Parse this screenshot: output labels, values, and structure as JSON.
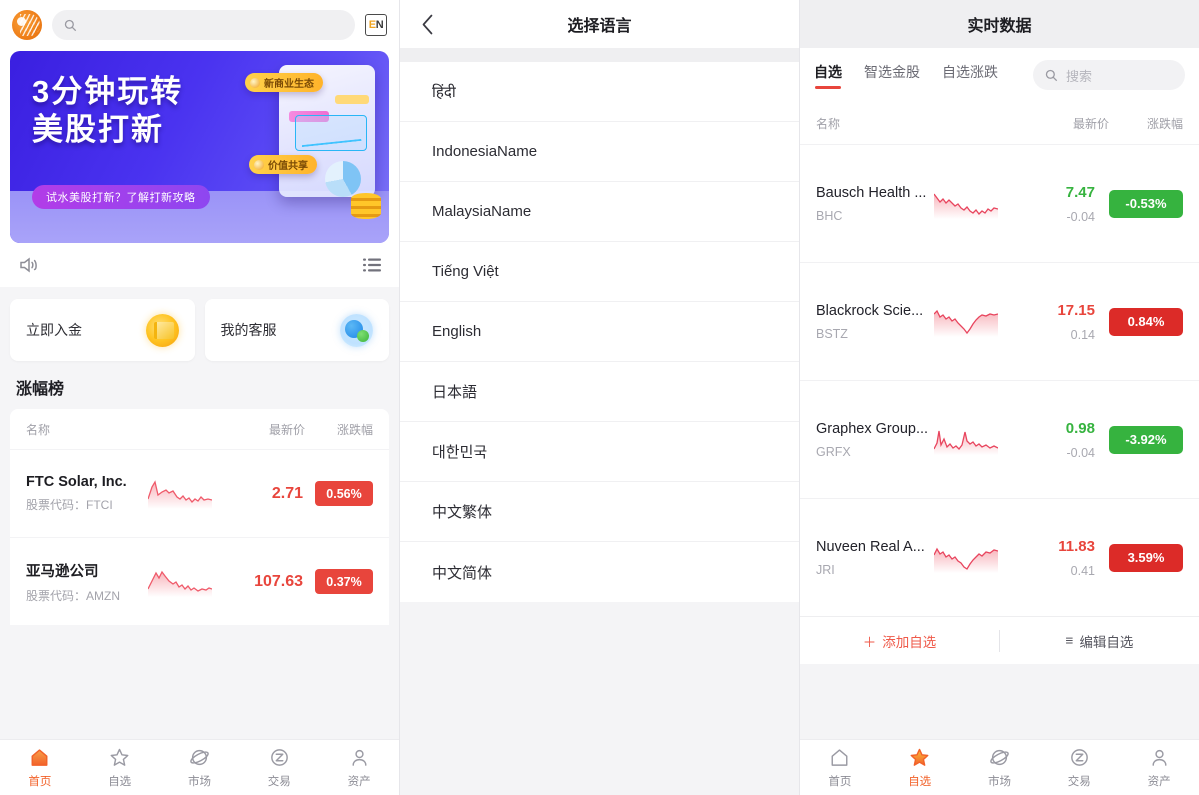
{
  "home": {
    "logo_name": "lion-logo",
    "search_placeholder": "",
    "lang_badge": {
      "first": "E",
      "second": "N"
    },
    "banner": {
      "line1": "3分钟玩转",
      "line2": "美股打新",
      "pill": "试水美股打新？了解打新攻略",
      "tag1": "新商业生态",
      "tag2": "价值共享"
    },
    "quick_actions": [
      {
        "label": "立即入金",
        "icon": "wallet-icon"
      },
      {
        "label": "我的客服",
        "icon": "customer-service-icon"
      }
    ],
    "section_title": "涨幅榜",
    "table_headers": {
      "name": "名称",
      "price": "最新价",
      "change": "涨跌幅"
    },
    "rows": [
      {
        "name": "FTC Solar, Inc.",
        "code_label": "股票代码：FTCI",
        "price": "2.71",
        "change": "0.56%",
        "direction": "up",
        "spark": "0,20 4,8 7,3 10,16 14,13 18,11 21,14 25,12 29,18 32,20 35,17 38,21 41,19 44,23 47,20 50,22 53,18 56,21 60,20 64,21"
      },
      {
        "name": "亚马逊公司",
        "code_label": "股票代码：AMZN",
        "price": "107.63",
        "change": "0.37%",
        "direction": "up",
        "spark": "0,22 4,14 8,6 11,11 14,5 17,9 21,14 25,17 28,15 31,20 34,18 37,22 40,19 43,23 46,21 50,24 54,22 58,23 61,21 64,22"
      }
    ],
    "nav": [
      {
        "label": "首页",
        "icon": "home-icon",
        "active": true
      },
      {
        "label": "自选",
        "icon": "star-icon",
        "active": false
      },
      {
        "label": "市场",
        "icon": "market-planet-icon",
        "active": false
      },
      {
        "label": "交易",
        "icon": "trade-icon",
        "active": false
      },
      {
        "label": "资产",
        "icon": "assets-person-icon",
        "active": false
      }
    ]
  },
  "language": {
    "title": "选择语言",
    "back_icon": "chevron-left-icon",
    "items": [
      "हिंदी",
      "IndonesiaName",
      "MalaysiaName",
      "Tiếng Việt",
      "English",
      "日本語",
      "대한민국",
      "中文繁体",
      "中文简体"
    ]
  },
  "quotes": {
    "title": "实时数据",
    "tabs": [
      {
        "label": "自选",
        "active": true
      },
      {
        "label": "智选金股",
        "active": false
      },
      {
        "label": "自选涨跌",
        "active": false
      }
    ],
    "search_placeholder": "搜索",
    "table_headers": {
      "name": "名称",
      "price": "最新价",
      "change": "涨跌幅"
    },
    "rows": [
      {
        "name": "Bausch Health ...",
        "code": "BHC",
        "price": "7.47",
        "delta": "-0.04",
        "change": "-0.53%",
        "direction": "down",
        "spark": "0,5 3,9 6,13 9,10 12,14 15,11 18,14 21,17 24,15 27,19 30,21 33,18 36,22 39,24 42,21 45,25 48,22 51,24 54,20 57,22 60,19 64,20"
      },
      {
        "name": "Blackrock Scie...",
        "code": "BSTZ",
        "price": "17.15",
        "delta": "0.14",
        "change": "0.84%",
        "direction": "up",
        "spark": "0,7 3,4 6,10 9,8 12,12 15,10 18,14 21,12 24,16 27,19 30,22 33,26 36,22 39,17 42,13 45,10 48,8 52,9 56,7 60,8 64,7"
      },
      {
        "name": "Graphex Group...",
        "code": "GRFX",
        "price": "0.98",
        "delta": "-0.04",
        "change": "-3.92%",
        "direction": "down",
        "spark": "0,24 3,18 5,6 7,20 10,14 13,22 16,19 19,23 22,21 25,24 28,20 31,7 33,16 36,19 39,17 42,21 45,19 48,22 52,20 56,23 60,21 64,23"
      },
      {
        "name": "Nuveen Real A...",
        "code": "JRI",
        "price": "11.83",
        "delta": "0.41",
        "change": "3.59%",
        "direction": "up",
        "spark": "0,12 3,6 6,11 9,9 12,14 15,12 18,16 21,14 24,18 27,20 30,24 33,26 36,21 39,17 42,14 45,11 48,13 52,9 56,10 60,7 64,8"
      }
    ],
    "actions": [
      {
        "label": "添加自选",
        "icon": "plus-icon",
        "kind": "add"
      },
      {
        "label": "编辑自选",
        "icon": "list-lines-icon",
        "kind": "edit"
      }
    ],
    "nav": [
      {
        "label": "首页",
        "icon": "home-icon",
        "active": false
      },
      {
        "label": "自选",
        "icon": "star-icon",
        "active": true
      },
      {
        "label": "市场",
        "icon": "market-planet-icon",
        "active": false
      },
      {
        "label": "交易",
        "icon": "trade-icon",
        "active": false
      },
      {
        "label": "资产",
        "icon": "assets-person-icon",
        "active": false
      }
    ]
  },
  "colors": {
    "up_red": "#e8453c",
    "down_green": "#36b33f",
    "accent_orange": "#f2622a",
    "muted": "#a0a0a8"
  }
}
